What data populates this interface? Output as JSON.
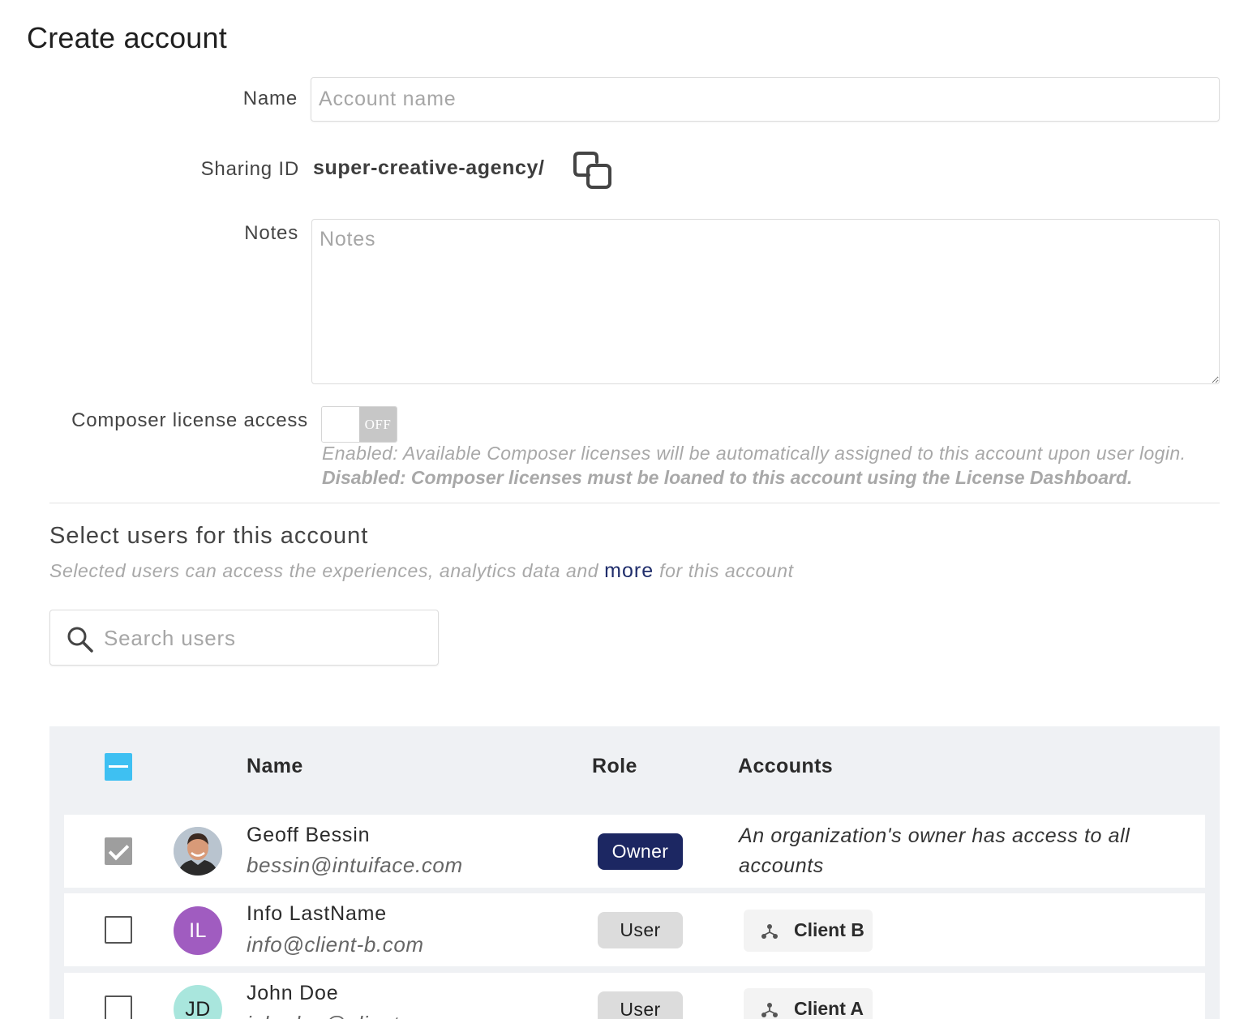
{
  "page": {
    "title": "Create account"
  },
  "form": {
    "name_label": "Name",
    "name_placeholder": "Account name",
    "name_value": "",
    "sharing_label": "Sharing ID",
    "sharing_value": "super-creative-agency/",
    "notes_label": "Notes",
    "notes_placeholder": "Notes",
    "notes_value": "",
    "composer_label": "Composer license access",
    "composer_toggle_state": "OFF",
    "composer_hint_enabled": "Enabled: Available Composer licenses will be automatically assigned to this account upon user login.",
    "composer_hint_disabled": "Disabled: Composer licenses must be loaned to this account using the License Dashboard."
  },
  "users_section": {
    "title": "Select users for this account",
    "desc_before": "Selected users can access the experiences, analytics data and ",
    "desc_link": "more",
    "desc_after": " for this account",
    "search_placeholder": "Search users",
    "search_value": ""
  },
  "table": {
    "columns": [
      "Name",
      "Role",
      "Accounts"
    ],
    "rows": [
      {
        "name": "Geoff Bessin",
        "email": "bessin@intuiface.com",
        "role": "Owner",
        "checked": true,
        "avatar": "photo",
        "accounts_note": "An organization's owner has access to all accounts",
        "account": ""
      },
      {
        "name": "Info LastName",
        "email": "info@client-b.com",
        "role": "User",
        "checked": false,
        "avatar": "IL",
        "avatar_color": "#a05cc0",
        "account": "Client B"
      },
      {
        "name": "John Doe",
        "email": "johndoe@client-a.com",
        "role": "User",
        "checked": false,
        "avatar": "JD",
        "avatar_color": "#a9e6dd",
        "account": "Client A"
      }
    ]
  },
  "icons": {
    "copy": "copy-icon",
    "search": "search-icon",
    "account": "hierarchy-icon"
  }
}
